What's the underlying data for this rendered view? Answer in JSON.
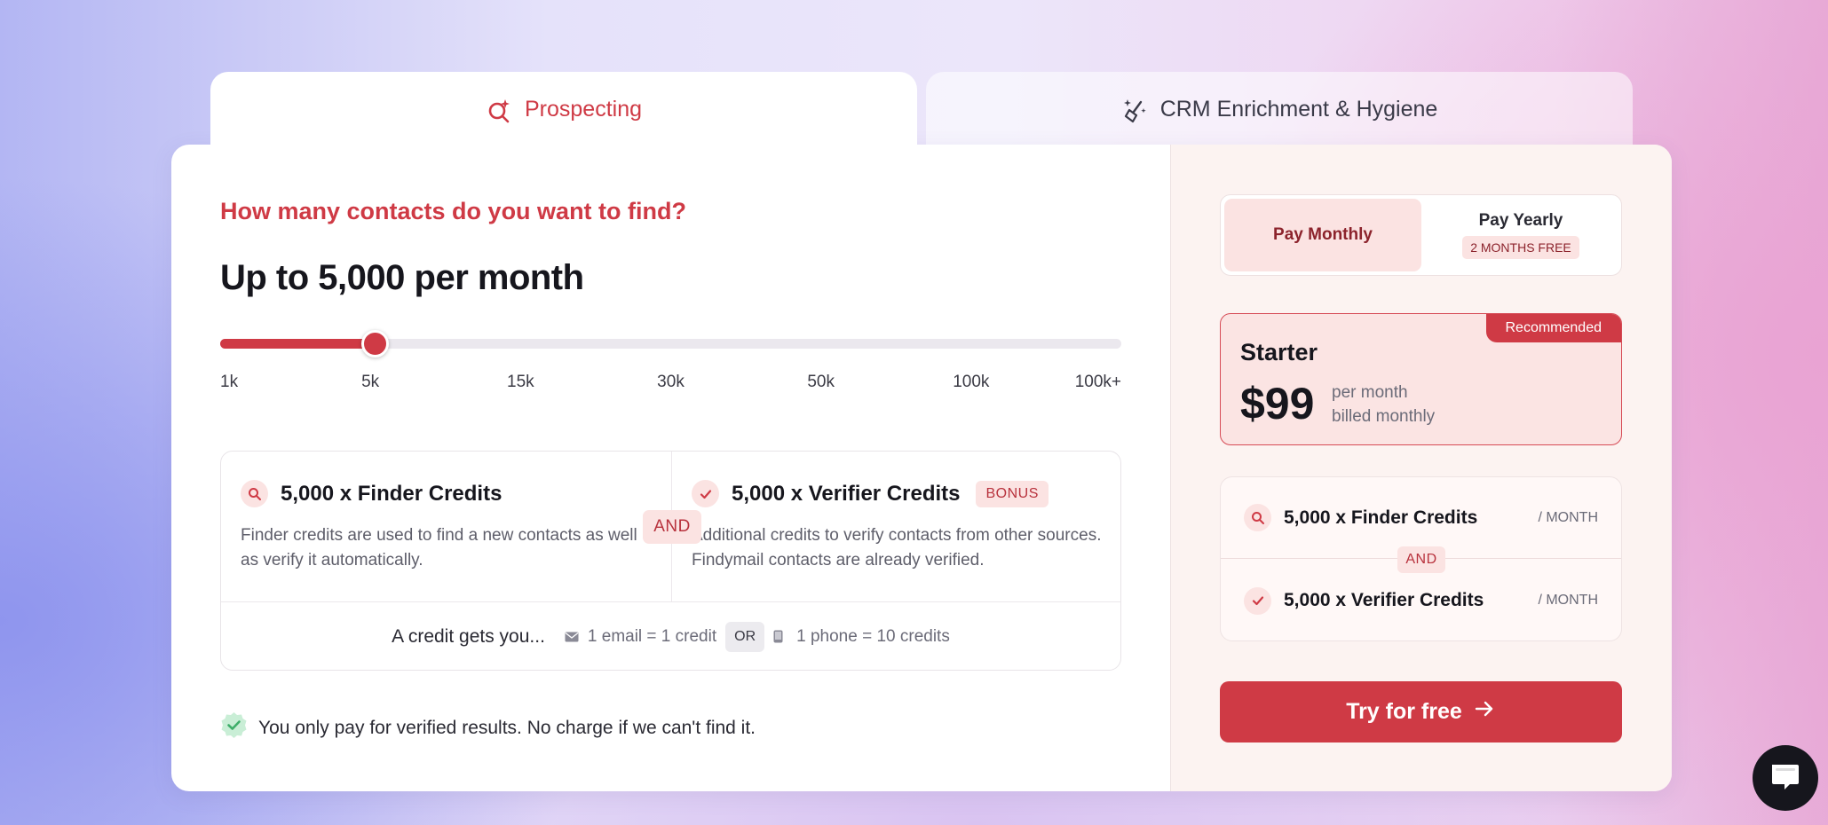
{
  "tabs": {
    "prospecting": "Prospecting",
    "crm": "CRM Enrichment & Hygiene"
  },
  "main": {
    "question": "How many contacts do you want to find?",
    "headline": "Up to 5,000 per month"
  },
  "slider": {
    "ticks": [
      "1k",
      "5k",
      "15k",
      "30k",
      "50k",
      "100k",
      "100k+"
    ],
    "selected_index": 1
  },
  "credits": {
    "finder": {
      "title": "5,000 x Finder Credits",
      "description": "Finder credits are used to find a new contacts as well as verify it automatically."
    },
    "and_label": "AND",
    "verifier": {
      "title": "5,000 x Verifier Credits",
      "bonus": "BONUS",
      "description": "Additional credits to verify contacts from other sources. Findymail contacts are already verified."
    },
    "info": {
      "lead": "A credit gets you...",
      "email": "1 email = 1 credit",
      "or": "OR",
      "phone": "1 phone = 10 credits"
    }
  },
  "guarantee": "You only pay for verified results. No charge if we can't find it.",
  "billing": {
    "monthly": "Pay Monthly",
    "yearly": "Pay Yearly",
    "yearly_badge": "2 MONTHS FREE"
  },
  "plan": {
    "badge": "Recommended",
    "name": "Starter",
    "price": "$99",
    "period_line1": "per month",
    "period_line2": "billed monthly"
  },
  "summary": {
    "finder": "5,000 x Finder Credits",
    "verifier": "5,000 x Verifier Credits",
    "per_month": "/ MONTH",
    "and_label": "AND"
  },
  "cta": "Try for free",
  "colors": {
    "accent": "#cf3a45",
    "accent_soft": "#fbe3e2",
    "verified_green": "#3fae6a"
  }
}
